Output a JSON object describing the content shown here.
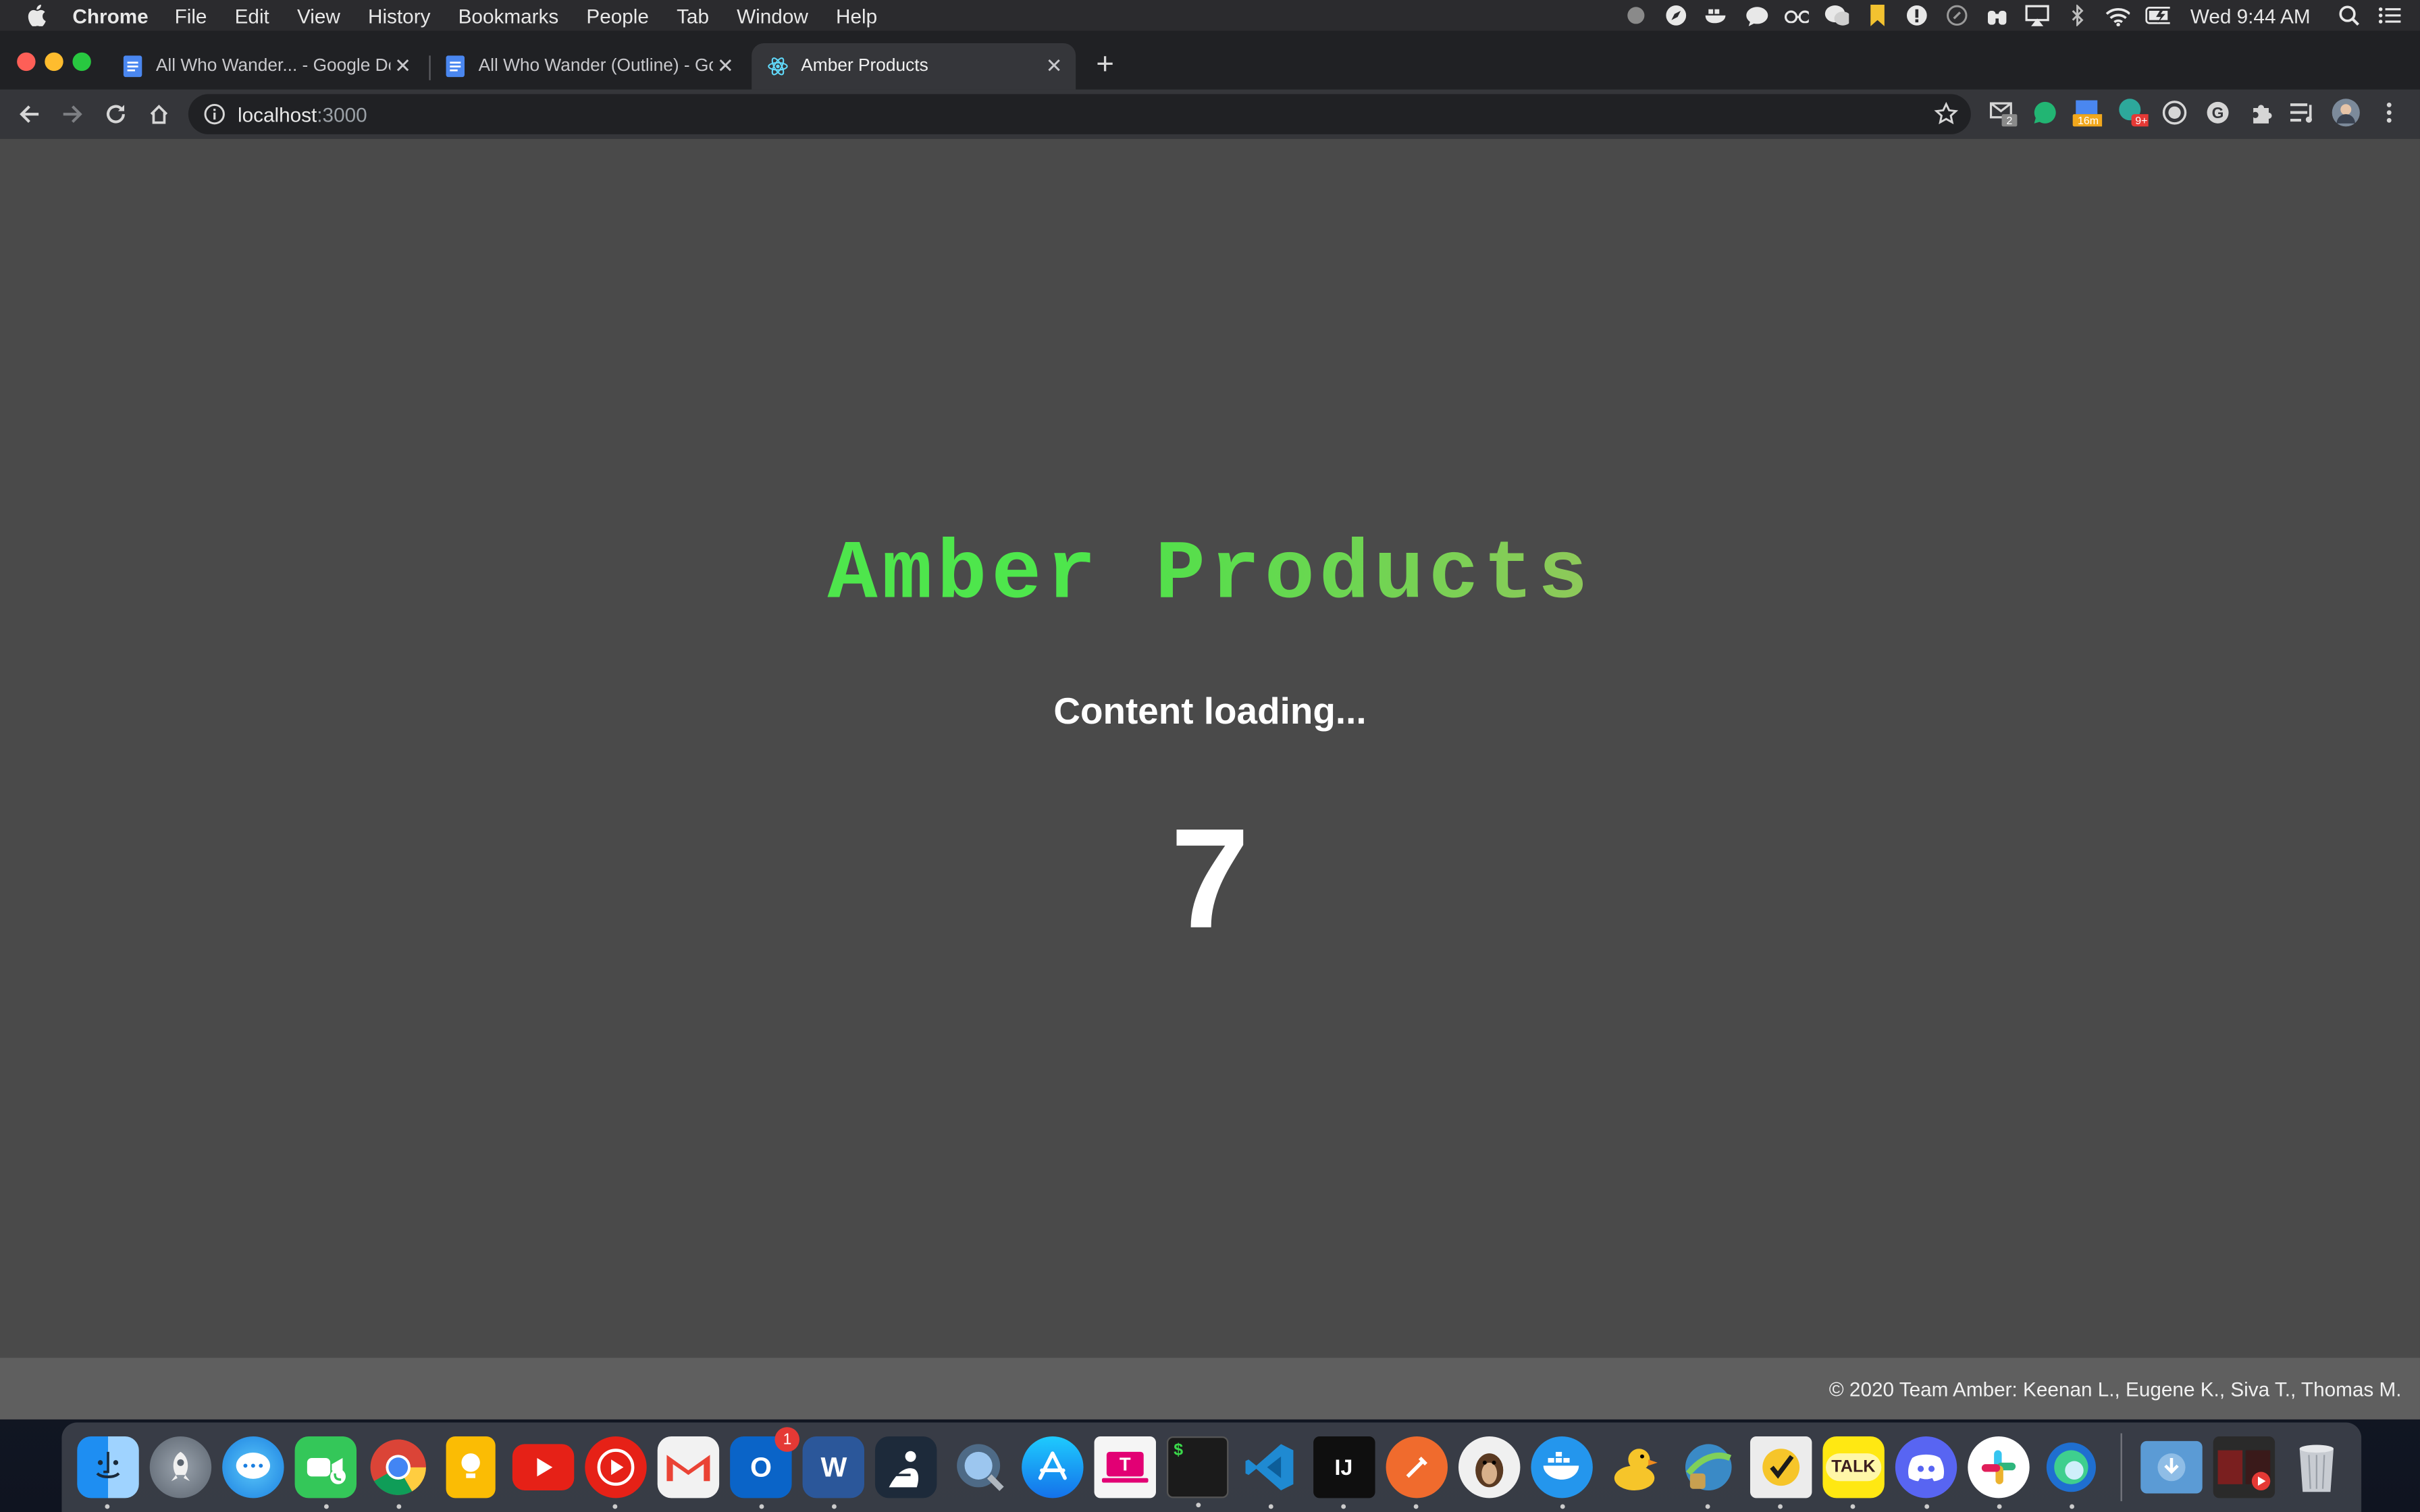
{
  "menubar": {
    "app_name": "Chrome",
    "items": [
      "File",
      "Edit",
      "View",
      "History",
      "Bookmarks",
      "People",
      "Tab",
      "Window",
      "Help"
    ],
    "clock": "Wed 9:44 AM"
  },
  "tabs": [
    {
      "title": "All Who Wander... - Google Docs",
      "icon": "google-docs-icon"
    },
    {
      "title": "All Who Wander (Outline) - Google Docs",
      "icon": "google-docs-icon"
    },
    {
      "title": "Amber Products",
      "icon": "react-icon",
      "active": true
    }
  ],
  "omnibox": {
    "host": "localhost",
    "port": ":3000"
  },
  "extensions": {
    "mail_badge": "2",
    "calendar_badge": "16m",
    "notif_badge": "9+"
  },
  "page": {
    "title_word1": "Amber",
    "title_word2": "Products",
    "loading_text": "Content loading...",
    "counter": "7",
    "footer": "© 2020 Team Amber: Keenan L., Eugene K., Siva T., Thomas M.",
    "colors": {
      "background": "#4a4a4a",
      "title_green": "#4ee64c",
      "footer_bg": "#5f5f5f"
    }
  },
  "dock": {
    "outlook_badge": "1",
    "apps": [
      "finder",
      "launchpad",
      "messages",
      "facetime",
      "chrome",
      "keep",
      "youtube",
      "youtube-music",
      "gmail",
      "outlook",
      "word",
      "kindle",
      "quicktime",
      "app-store",
      "t-mobile",
      "terminal",
      "vscode",
      "intellij",
      "postman",
      "sequel-ace",
      "docker",
      "cyberduck",
      "vpn",
      "norton",
      "kakaotalk",
      "discord",
      "slack",
      "edge",
      "downloads",
      "media",
      "trash"
    ],
    "terminal_text": "$",
    "intellij_text": "IJ",
    "kakaotalk_text": "TALK",
    "word_text": "W",
    "outlook_text": "O",
    "tmobile_text": "T"
  }
}
